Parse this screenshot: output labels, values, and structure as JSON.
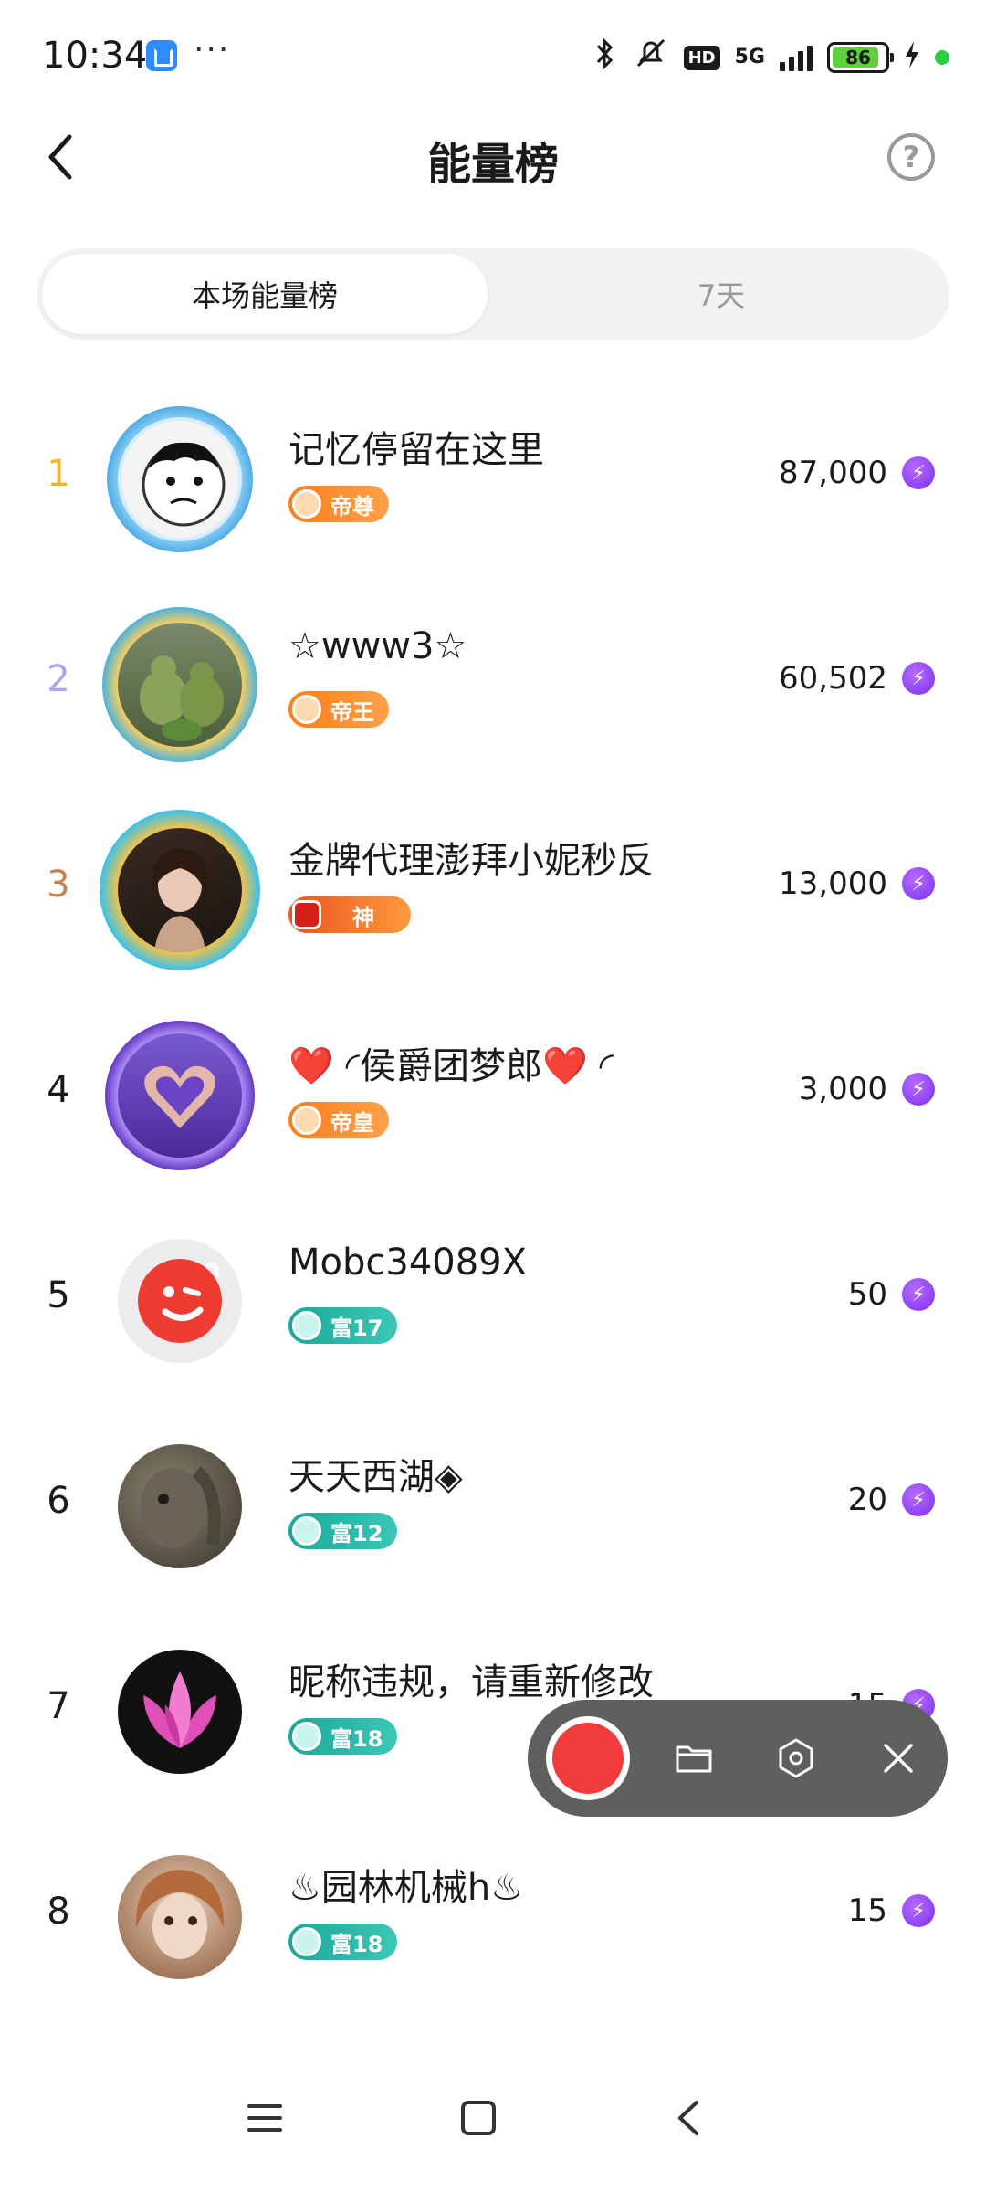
{
  "status_bar": {
    "time": "10:34",
    "dots": "···",
    "network": "5G",
    "hd": "HD",
    "battery": "86",
    "icons": [
      "home-app-icon",
      "bluetooth-icon",
      "mute-icon",
      "hd-icon",
      "5g-signal-icon",
      "battery-icon",
      "charging-icon"
    ]
  },
  "header": {
    "title": "能量榜",
    "help": "?"
  },
  "tabs": [
    {
      "label": "本场能量榜",
      "active": true
    },
    {
      "label": "7天",
      "active": false
    }
  ],
  "ranking": [
    {
      "rank": "1",
      "name": "记忆停留在这里",
      "badge": "帝尊",
      "score": "87,000"
    },
    {
      "rank": "2",
      "name": "☆www3☆",
      "badge": "帝王",
      "score": "60,502"
    },
    {
      "rank": "3",
      "name": "金牌代理澎拜小妮秒反",
      "badge": "神",
      "score": "13,000"
    },
    {
      "rank": "4",
      "name": "❤️ ◜侯爵团梦郎❤️ ◜",
      "badge": "帝皇",
      "score": "3,000"
    },
    {
      "rank": "5",
      "name": "Mobc34089X",
      "badge": "富17",
      "score": "50"
    },
    {
      "rank": "6",
      "name": "天天西湖◈",
      "badge": "富12",
      "score": "20"
    },
    {
      "rank": "7",
      "name": "昵称违规，请重新修改",
      "badge": "富18",
      "score": "15"
    },
    {
      "rank": "8",
      "name": "♨园林机械h♨",
      "badge": "富18",
      "score": "15"
    }
  ],
  "colors": {
    "rank1": "#f0b32a",
    "rank2": "#a9a6e8",
    "rank3": "#c9834f",
    "default_rank": "#1a1a1a",
    "energy": "#8a3cf5",
    "record": "#f23b3b"
  },
  "recorder": {
    "icons": [
      "record-icon",
      "folder-icon",
      "settings-icon",
      "close-icon"
    ]
  },
  "nav_bar": {
    "icons": [
      "menu-icon",
      "home-icon",
      "back-icon"
    ]
  }
}
